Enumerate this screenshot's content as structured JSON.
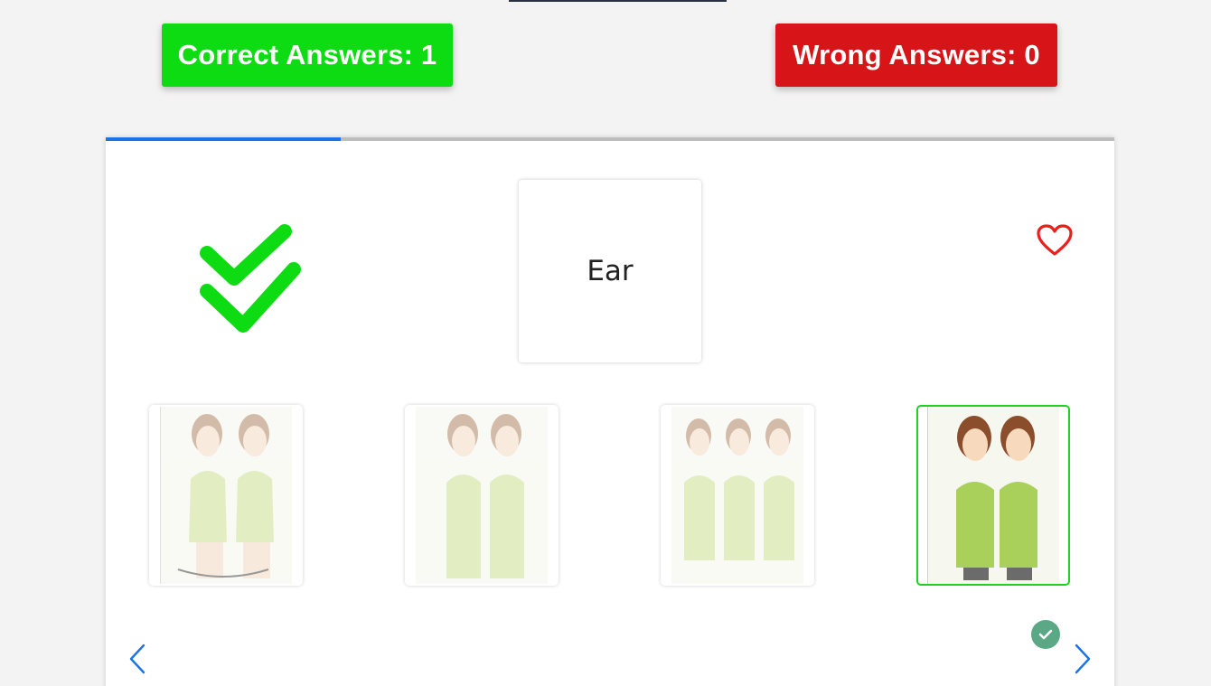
{
  "score": {
    "correct_label": "Correct Answers: 1",
    "wrong_label": "Wrong Answers: 0",
    "correct_color": "#0ddc13",
    "wrong_color": "#d71518"
  },
  "progress": {
    "fraction": 0.233,
    "fill_color": "#1a73e8"
  },
  "question": {
    "word": "Ear"
  },
  "status": {
    "result_icon": "double-check-icon",
    "result_color": "#0ddc13"
  },
  "favorite": {
    "icon": "heart-icon",
    "color": "#e8211d"
  },
  "options": [
    {
      "icon": "sign-illustration-1",
      "selected": false
    },
    {
      "icon": "sign-illustration-2",
      "selected": false
    },
    {
      "icon": "sign-illustration-3",
      "selected": false
    },
    {
      "icon": "sign-illustration-4",
      "selected": true,
      "border_color": "#22d020"
    }
  ],
  "navigation": {
    "prev_icon": "chevron-left-icon",
    "next_icon": "chevron-right-icon",
    "color": "#1a73e8"
  },
  "answer_badge": {
    "icon": "check-circle-icon",
    "color": "#5aa886"
  }
}
